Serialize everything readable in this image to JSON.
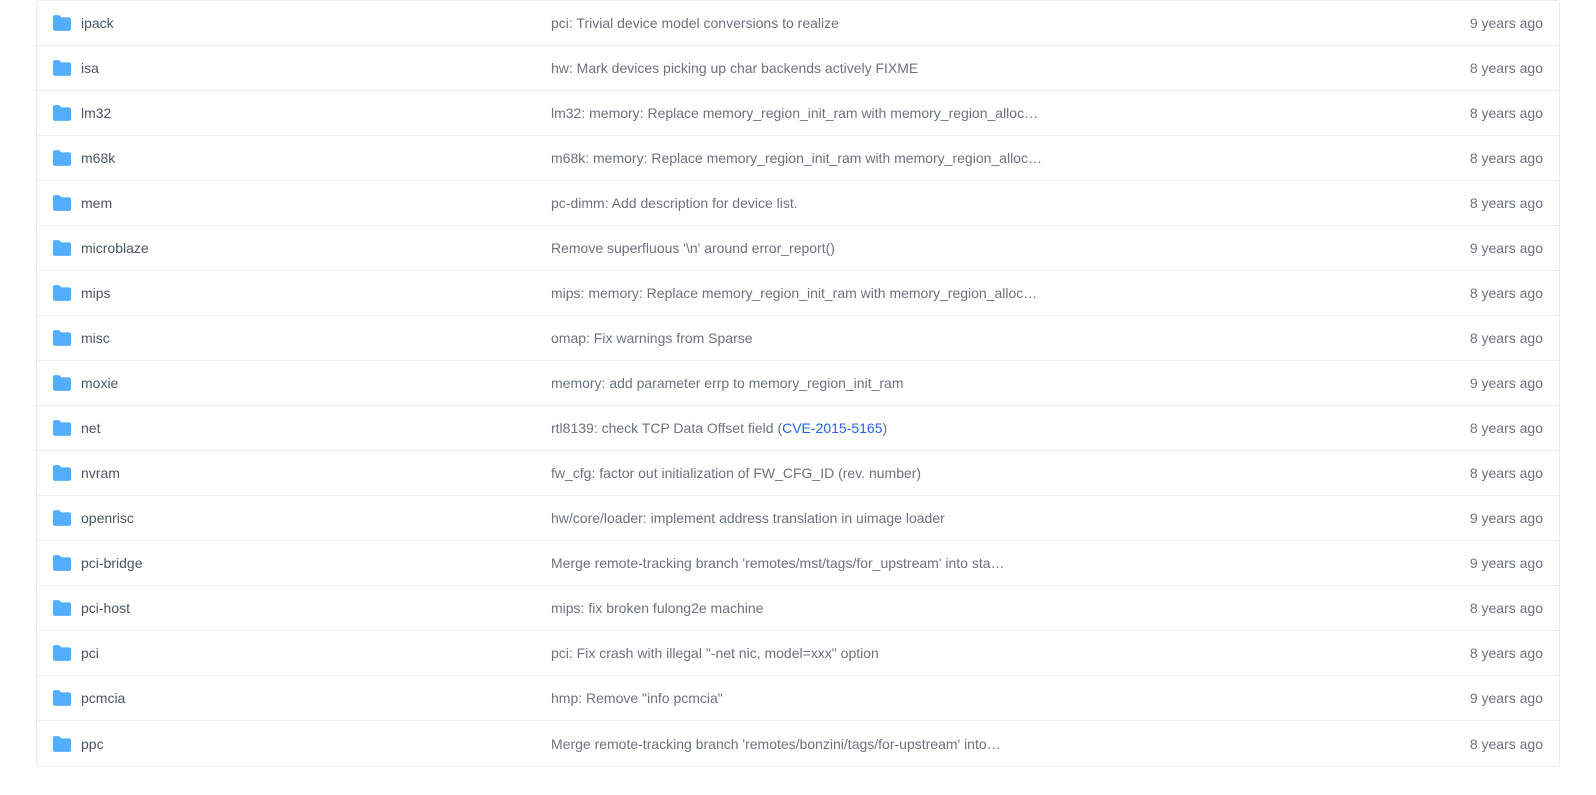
{
  "files": [
    {
      "name": "ipack",
      "message": "pci: Trivial device model conversions to realize",
      "age": "9 years ago",
      "issue": null
    },
    {
      "name": "isa",
      "message": "hw: Mark devices picking up char backends actively FIXME",
      "age": "8 years ago",
      "issue": null
    },
    {
      "name": "lm32",
      "message": "lm32: memory: Replace memory_region_init_ram with memory_region_alloc…",
      "age": "8 years ago",
      "issue": null
    },
    {
      "name": "m68k",
      "message": "m68k: memory: Replace memory_region_init_ram with memory_region_alloc…",
      "age": "8 years ago",
      "issue": null
    },
    {
      "name": "mem",
      "message": "pc-dimm: Add description for device list.",
      "age": "8 years ago",
      "issue": null
    },
    {
      "name": "microblaze",
      "message": "Remove superfluous '\\n' around error_report()",
      "age": "9 years ago",
      "issue": null
    },
    {
      "name": "mips",
      "message": "mips: memory: Replace memory_region_init_ram with memory_region_alloc…",
      "age": "8 years ago",
      "issue": null
    },
    {
      "name": "misc",
      "message": "omap: Fix warnings from Sparse",
      "age": "8 years ago",
      "issue": null
    },
    {
      "name": "moxie",
      "message": "memory: add parameter errp to memory_region_init_ram",
      "age": "9 years ago",
      "issue": null
    },
    {
      "name": "net",
      "message_prefix": "rtl8139: check TCP Data Offset field (",
      "issue": "CVE-2015-5165",
      "message_suffix": ")",
      "age": "8 years ago"
    },
    {
      "name": "nvram",
      "message": "fw_cfg: factor out initialization of FW_CFG_ID (rev. number)",
      "age": "8 years ago",
      "issue": null
    },
    {
      "name": "openrisc",
      "message": "hw/core/loader: implement address translation in uimage loader",
      "age": "9 years ago",
      "issue": null
    },
    {
      "name": "pci-bridge",
      "message": "Merge remote-tracking branch 'remotes/mst/tags/for_upstream' into sta…",
      "age": "9 years ago",
      "issue": null
    },
    {
      "name": "pci-host",
      "message": "mips: fix broken fulong2e machine",
      "age": "8 years ago",
      "issue": null
    },
    {
      "name": "pci",
      "message": "pci: Fix crash with illegal \"-net nic, model=xxx\" option",
      "age": "8 years ago",
      "issue": null
    },
    {
      "name": "pcmcia",
      "message": "hmp: Remove \"info pcmcia\"",
      "age": "9 years ago",
      "issue": null
    },
    {
      "name": "ppc",
      "message": "Merge remote-tracking branch 'remotes/bonzini/tags/for-upstream' into…",
      "age": "8 years ago",
      "issue": null
    }
  ]
}
